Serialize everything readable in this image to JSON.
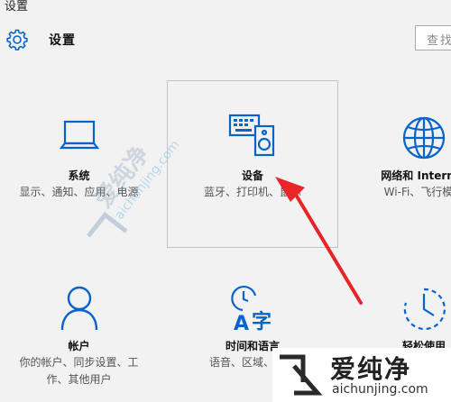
{
  "window": {
    "title": "设置"
  },
  "header": {
    "title": "设置",
    "icon": "gear-icon"
  },
  "search": {
    "placeholder": "查找设置"
  },
  "tiles": [
    {
      "id": "system",
      "icon": "laptop-icon",
      "name": "系统",
      "desc": "显示、通知、应用、电源"
    },
    {
      "id": "devices",
      "icon": "devices-icon",
      "name": "设备",
      "desc": "蓝牙、打印机、鼠标"
    },
    {
      "id": "network",
      "icon": "globe-icon",
      "name": "网络和 Internet",
      "desc": "Wi-Fi、飞行模式"
    },
    {
      "id": "accounts",
      "icon": "person-icon",
      "name": "帐户",
      "desc": "你的帐户、同步设置、工作、其他用户"
    },
    {
      "id": "time-language",
      "icon": "time-language-icon",
      "name": "时间和语言",
      "desc": "语音、区域、日期"
    },
    {
      "id": "ease-of-access",
      "icon": "ease-of-access-icon",
      "name": "轻松使用",
      "desc": ""
    }
  ],
  "watermark": {
    "brand": "爱纯净",
    "url": "aichunjing.com"
  },
  "colors": {
    "accent": "#0a64c8",
    "arrow": "#e8262a",
    "background": "#f2f2f2"
  }
}
